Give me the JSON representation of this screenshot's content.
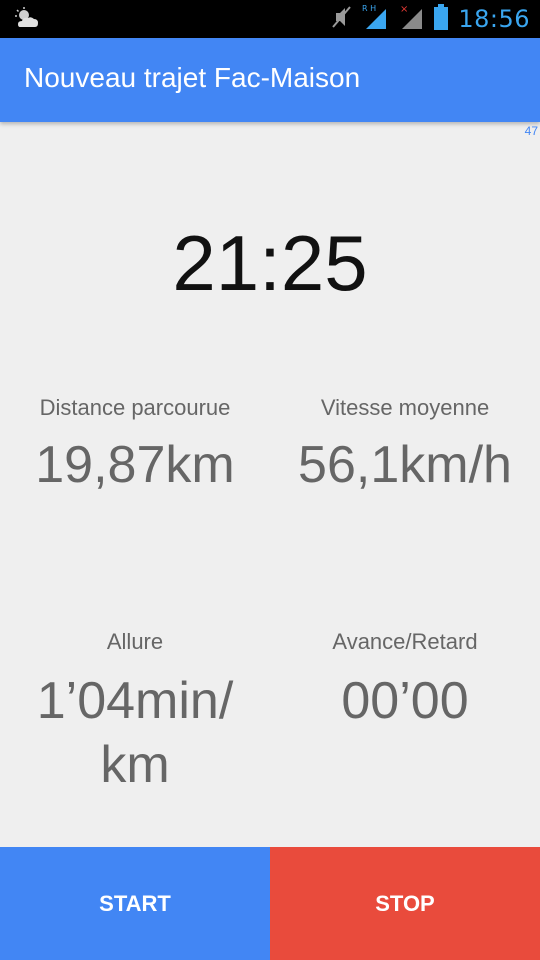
{
  "status_bar": {
    "time": "18:56",
    "icons": [
      "weather-icon",
      "mute-icon",
      "signal-rh-icon",
      "signal-off-icon",
      "battery-icon"
    ]
  },
  "app_bar": {
    "title": "Nouveau trajet Fac-Maison"
  },
  "corner_value": "47",
  "timer": "21:25",
  "stats": {
    "distance": {
      "label": "Distance parcourue",
      "value": "19,87km"
    },
    "speed": {
      "label": "Vitesse moyenne",
      "value": "56,1km/h"
    },
    "pace": {
      "label": "Allure",
      "value_line1": "1’04min/",
      "value_line2": "km"
    },
    "delta": {
      "label": "Avance/Retard",
      "value": "00’00"
    }
  },
  "buttons": {
    "start": "START",
    "stop": "STOP"
  },
  "colors": {
    "primary": "#4286f4",
    "stop": "#e94b3c",
    "background": "#efefef",
    "status_time": "#3aa6f0"
  }
}
